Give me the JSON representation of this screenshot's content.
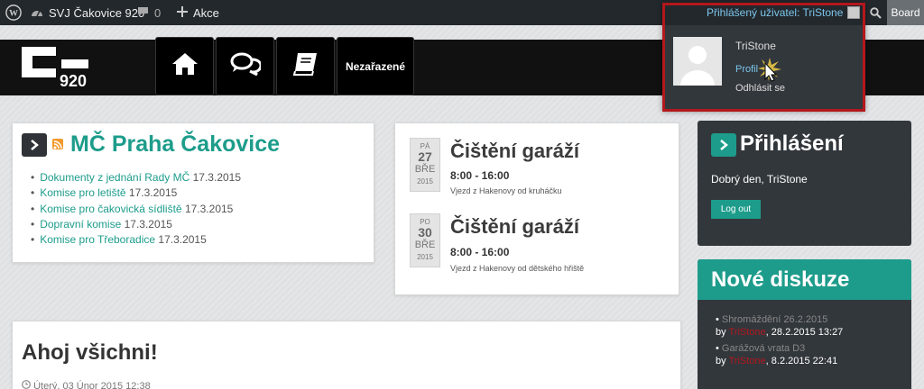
{
  "adminbar": {
    "site_name": "SVJ Čakovice 920",
    "comments_count": "0",
    "new_label": "Akce",
    "board_label": "Board"
  },
  "user_menu": {
    "greeting": "Přihlášený uživatel: TriStone",
    "name": "TriStone",
    "profile_label": "Profil",
    "logout_label": "Odhlásit se"
  },
  "header": {
    "logo_number": "920",
    "nav": [
      {
        "icon": "home-icon"
      },
      {
        "icon": "comments-icon"
      },
      {
        "icon": "book-icon"
      },
      {
        "label": "Nezařazené"
      }
    ]
  },
  "news": {
    "title": "MČ Praha Čakovice",
    "items": [
      {
        "link": "Dokumenty z jednání Rady MČ",
        "date": "17.3.2015"
      },
      {
        "link": "Komise pro letiště",
        "date": "17.3.2015"
      },
      {
        "link": "Komise pro čakovická sídliště",
        "date": "17.3.2015"
      },
      {
        "link": "Dopravní komise",
        "date": "17.3.2015"
      },
      {
        "link": "Komise pro Třeboradice",
        "date": "17.3.2015"
      }
    ]
  },
  "events": [
    {
      "weekday": "PÁ",
      "day": "27",
      "month": "BŘE",
      "year": "2015",
      "title": "Čištění garáží",
      "time": "8:00 - 16:00",
      "desc": "Vjezd z Hakenovy od kruháčku"
    },
    {
      "weekday": "PO",
      "day": "30",
      "month": "BŘE",
      "year": "2015",
      "title": "Čištění garáží",
      "time": "8:00 - 16:00",
      "desc": "Vjezd z Hakenovy od dětského hřiště"
    }
  ],
  "post": {
    "title": "Ahoj všichni!",
    "meta": "Úterý, 03 Únor 2015 12:38"
  },
  "login_widget": {
    "title": "Přihlášení",
    "greeting": "Dobrý den, TriStone",
    "logout_button": "Log out"
  },
  "discussions_widget": {
    "title": "Nové diskuze",
    "items": [
      {
        "title": "Shromáždění 26.2.2015",
        "by": "by",
        "author": "TriStone",
        "date": "28.2.2015 13:27"
      },
      {
        "title": "Garážová vrata D3",
        "by": "by",
        "author": "TriStone",
        "date": "8.2.2015 22:41"
      }
    ]
  },
  "colors": {
    "accent": "#1d9c8b",
    "highlight_border": "#b3171c",
    "dark_panel": "#32373c"
  }
}
